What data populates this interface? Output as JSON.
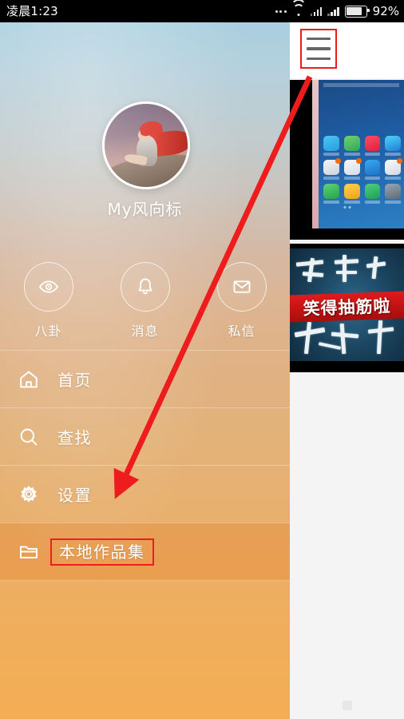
{
  "status_bar": {
    "time": "凌晨1:23",
    "battery_percent": "92%",
    "icons": [
      "more-dots-icon",
      "wifi-icon",
      "signal-icon",
      "signal-icon",
      "battery-icon"
    ]
  },
  "drawer": {
    "profile": {
      "avatar_alt": "user-avatar-photo",
      "username": "My风向标"
    },
    "quick_actions": [
      {
        "label": "八卦",
        "icon": "eye-icon"
      },
      {
        "label": "消息",
        "icon": "bell-icon"
      },
      {
        "label": "私信",
        "icon": "envelope-icon"
      }
    ],
    "menu_items": [
      {
        "label": "首页",
        "icon": "home-icon",
        "active": false
      },
      {
        "label": "查找",
        "icon": "search-icon",
        "active": false
      },
      {
        "label": "设置",
        "icon": "gear-icon",
        "active": false
      },
      {
        "label": "本地作品集",
        "icon": "folder-icon",
        "active": true
      }
    ]
  },
  "content_panel": {
    "menu_button": {
      "name": "hamburger-menu-button",
      "highlighted": true
    },
    "thumbnails": [
      {
        "name": "thumbnail-phone-homescreen",
        "caption": ""
      },
      {
        "name": "thumbnail-calligraphy-banner",
        "caption": "笑得抽筋啦"
      }
    ]
  },
  "annotations": {
    "highlight_color": "#ee1c1c",
    "arrow": {
      "from": "hamburger-menu-button",
      "to": "本地作品集"
    }
  },
  "colors": {
    "accent_red": "#ee1c1c",
    "drawer_top": "#a9cfe0",
    "drawer_bottom": "#f4ad53",
    "status_bar_bg": "#000000"
  }
}
